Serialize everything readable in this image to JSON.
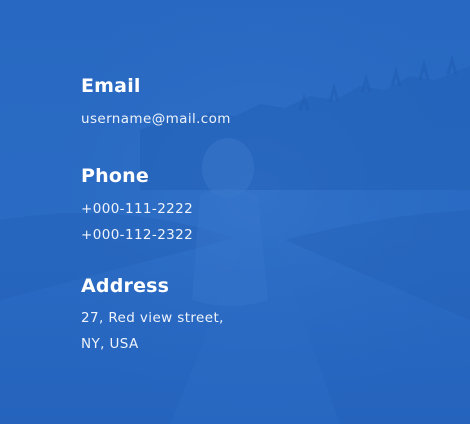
{
  "contact": {
    "email": {
      "heading": "Email",
      "value": "username@mail.com"
    },
    "phone": {
      "heading": "Phone",
      "lines": [
        "+000-111-2222",
        "+000-112-2322"
      ]
    },
    "address": {
      "heading": "Address",
      "lines": [
        "27, Red view street,",
        "NY, USA"
      ]
    }
  },
  "colors": {
    "overlay": "#2466c0",
    "text": "#ffffff"
  }
}
